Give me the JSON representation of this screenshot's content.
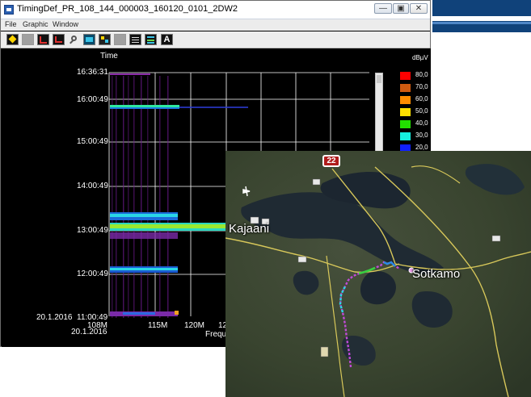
{
  "window": {
    "title": "TimingDef_PR_108_144_000003_160120_0101_2DW2",
    "controls": {
      "minimize": "—",
      "maximize": "▣",
      "close": "✕"
    }
  },
  "menu": [
    "File",
    "Graphic",
    "Window"
  ],
  "toolbar": {
    "icons": [
      "diamond-icon",
      "gray-square-icon",
      "chart-icon",
      "chart-red-icon",
      "zoom-icon",
      "cyan-grid-icon",
      "waterfall-icon",
      "gray-square-icon",
      "list-icon",
      "bars-icon",
      "text-a-icon"
    ],
    "text_button": "A"
  },
  "plot": {
    "time_header": "Time",
    "y_ticks": [
      "16:36:31",
      "16:00:49",
      "15:00:49",
      "14:00:49",
      "13:00:49",
      "12:00:49",
      "20.1.2016  11:00:49"
    ],
    "date_label": "20.1.2016",
    "x_ticks": [
      "108M",
      "115M",
      "120M",
      "12"
    ],
    "x_label_partial": "Frequ",
    "unit": "dBµV",
    "legend": [
      {
        "value": "80,0",
        "color": "#ff0000"
      },
      {
        "value": "70,0",
        "color": "#d05a10"
      },
      {
        "value": "60,0",
        "color": "#ff8c00"
      },
      {
        "value": "50,0",
        "color": "#ffe000"
      },
      {
        "value": "40,0",
        "color": "#22e000"
      },
      {
        "value": "30,0",
        "color": "#16f0e0"
      },
      {
        "value": "20,0",
        "color": "#1020ff"
      }
    ]
  },
  "map": {
    "labels": {
      "kajaani": "Kajaani",
      "sotkamo": "Sotkamo"
    },
    "road_number": "22"
  }
}
